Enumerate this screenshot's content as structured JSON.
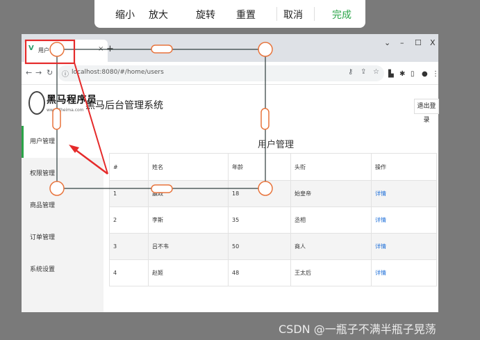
{
  "toolbar": {
    "zoom_out": "缩小",
    "zoom_in": "放大",
    "rotate": "旋转",
    "reset": "重置",
    "cancel": "取消",
    "done": "完成",
    "done_color": "#2aa548"
  },
  "browser": {
    "tab_title": "用户管理",
    "tab_icon": "vue-logo-icon",
    "url": "localhost:8080/#/home/users",
    "window_controls": [
      "v",
      "–",
      "☐",
      "X"
    ]
  },
  "app": {
    "logo_text": "黑马程序员",
    "logo_sub": "www.itheima.com",
    "title": "黑马后台管理系统",
    "logout": "退出登录"
  },
  "sidebar": {
    "items": [
      {
        "label": "用户管理",
        "active": true
      },
      {
        "label": "权限管理",
        "active": false
      },
      {
        "label": "商品管理",
        "active": false
      },
      {
        "label": "订单管理",
        "active": false
      },
      {
        "label": "系统设置",
        "active": false
      }
    ],
    "accent": "#2aa548"
  },
  "main": {
    "heading": "用户管理",
    "columns": [
      "#",
      "姓名",
      "年龄",
      "头衔",
      "操作"
    ],
    "rows": [
      [
        "1",
        "嬴政",
        "18",
        "始皇帝",
        "详情"
      ],
      [
        "2",
        "李斯",
        "35",
        "丞相",
        "详情"
      ],
      [
        "3",
        "吕不韦",
        "50",
        "商人",
        "详情"
      ],
      [
        "4",
        "赵姬",
        "48",
        "王太后",
        "详情"
      ]
    ],
    "link_color": "#1e6fd9"
  },
  "annotation": {
    "highlight_color": "#e52a2a",
    "crop_handle_color": "#e8743c"
  },
  "watermark": "CSDN @一瓶子不满半瓶子晃荡"
}
